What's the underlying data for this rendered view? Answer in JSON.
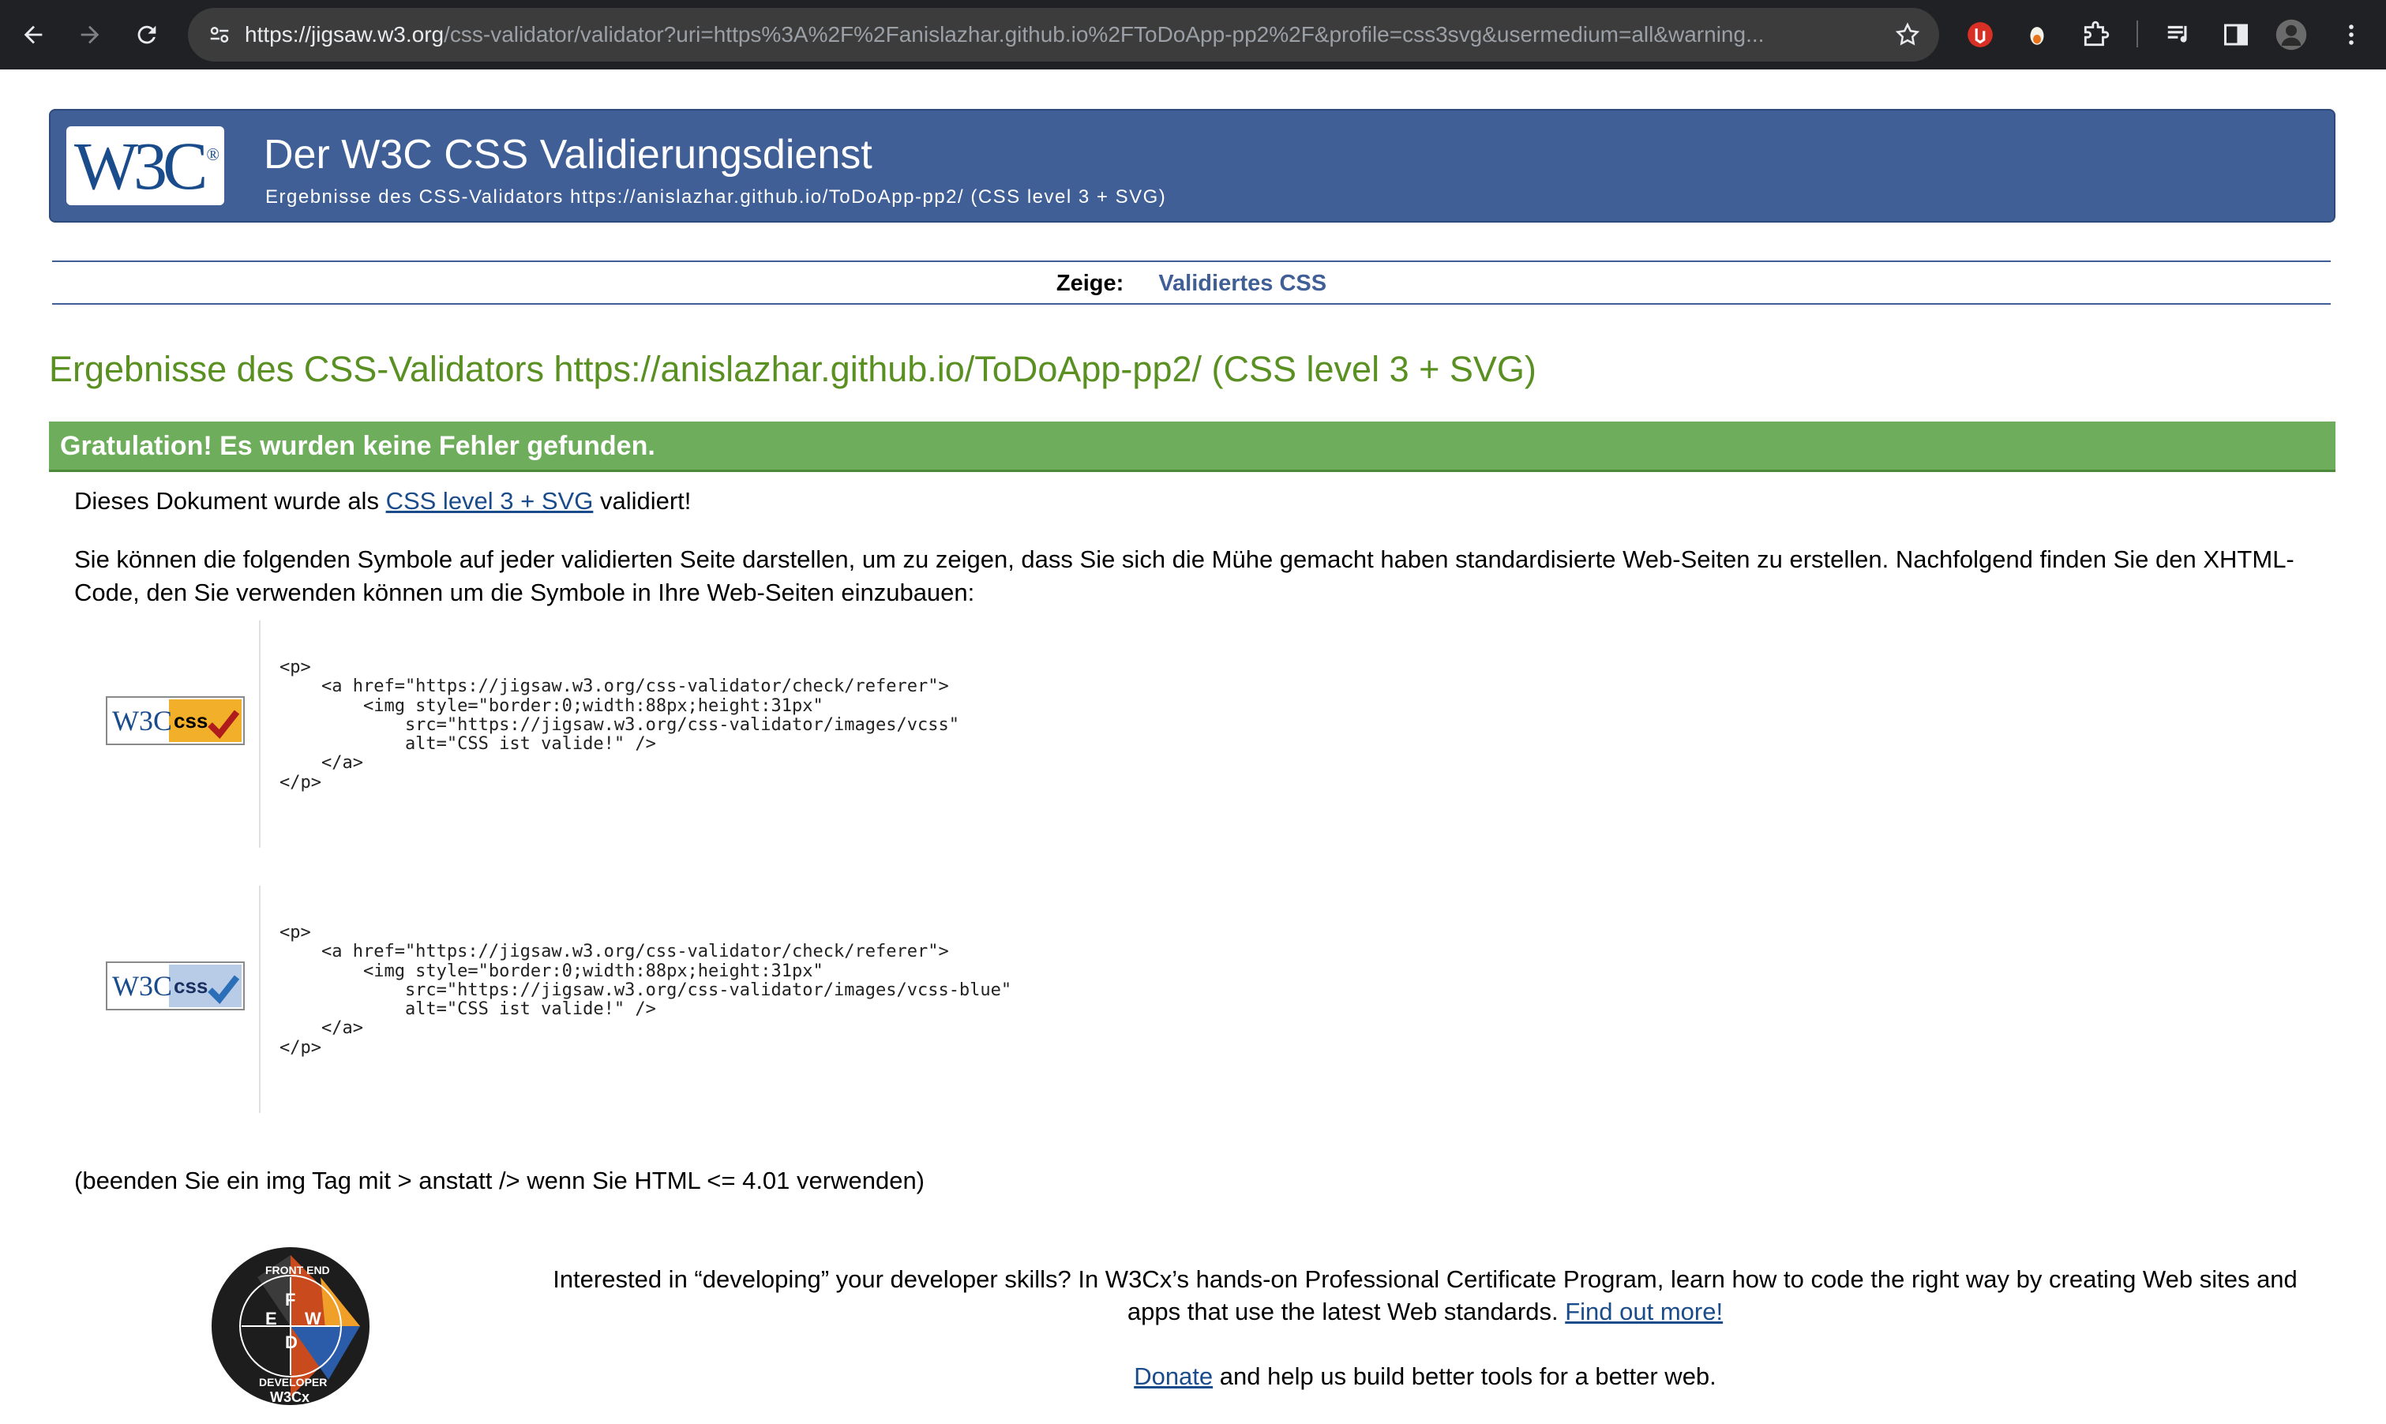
{
  "browser": {
    "url_host": "https://jigsaw.w3.org",
    "url_rest": "/css-validator/validator?uri=https%3A%2F%2Fanislazhar.github.io%2FToDoApp-pp2%2F&profile=css3svg&usermedium=all&warning..."
  },
  "header": {
    "logo_text": "W3C",
    "logo_reg": "®",
    "title": "Der W3C CSS Validierungsdienst",
    "subtitle": "Ergebnisse des CSS-Validators https://anislazhar.github.io/ToDoApp-pp2/ (CSS level 3 + SVG)"
  },
  "view": {
    "label": "Zeige:",
    "link": "Validiertes CSS"
  },
  "results": {
    "title": "Ergebnisse des CSS-Validators https://anislazhar.github.io/ToDoApp-pp2/ (CSS level 3 + SVG)",
    "success": "Gratulation! Es wurden keine Fehler gefunden.",
    "validated_prefix": "Dieses Dokument wurde als",
    "validated_link": "CSS level 3 + SVG",
    "validated_suffix": "validiert!",
    "symbols_text": "Sie können die folgenden Symbole auf jeder validierten Seite darstellen, um zu zeigen, dass Sie sich die Mühe gemacht haben standardisierte Web-Seiten zu erstellen. Nachfolgend finden Sie den XHTML-Code, den Sie verwenden können um die Symbole in Ihre Web-Seiten einzubauen:"
  },
  "badges": [
    {
      "w3c": "W3C",
      "css": "css",
      "code": "<p>\n    <a href=\"https://jigsaw.w3.org/css-validator/check/referer\">\n        <img style=\"border:0;width:88px;height:31px\"\n            src=\"https://jigsaw.w3.org/css-validator/images/vcss\"\n            alt=\"CSS ist valide!\" />\n    </a>\n</p>"
    },
    {
      "w3c": "W3C",
      "css": "css",
      "code": "<p>\n    <a href=\"https://jigsaw.w3.org/css-validator/check/referer\">\n        <img style=\"border:0;width:88px;height:31px\"\n            src=\"https://jigsaw.w3.org/css-validator/images/vcss-blue\"\n            alt=\"CSS ist valide!\" />\n    </a>\n</p>"
    }
  ],
  "note": "(beenden Sie ein img Tag mit > anstatt /> wenn Sie HTML <= 4.01 verwenden)",
  "promo": {
    "text": "Interested in “developing” your developer skills? In W3Cx’s hands-on Professional Certificate Program, learn how to code the right way by creating Web sites and apps that use the latest Web standards.",
    "link": "Find out more!",
    "donate_link": "Donate",
    "donate_rest": "and help us build better tools for a better web.",
    "badge_top": "FRONT END",
    "badge_bottom": "DEVELOPER",
    "badge_letters": [
      "F",
      "E",
      "W",
      "D"
    ],
    "badge_brand": "W3Cx"
  },
  "colors": {
    "header_bg": "#3f5f96",
    "title_green": "#5a8f22",
    "success_green": "#6ead5c",
    "link_blue": "#1a4c8c"
  }
}
